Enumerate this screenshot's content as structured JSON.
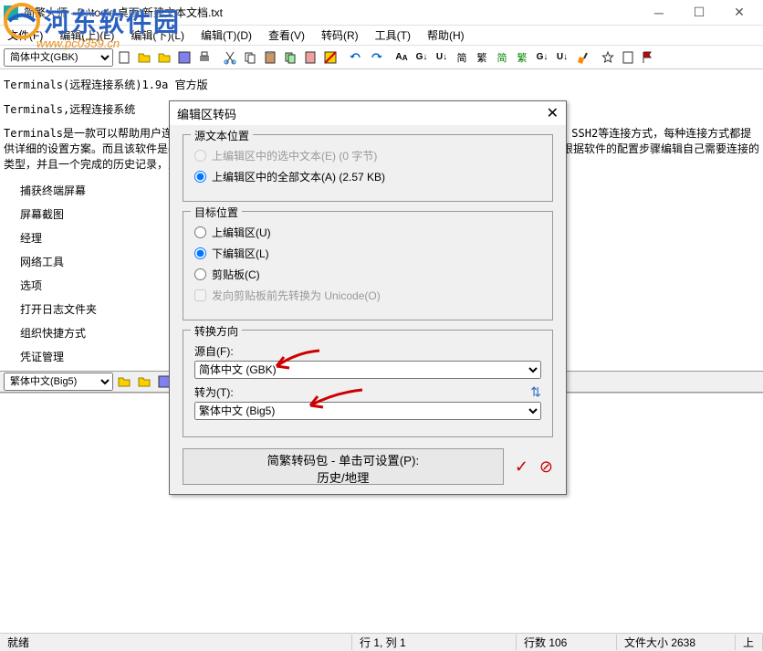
{
  "window": {
    "title": "简繁大师 - D:\\tools\\桌面\\新建文本文档.txt"
  },
  "watermark": {
    "text": "河东软件园",
    "url": "www.pc0359.cn"
  },
  "menu": {
    "items": [
      "文件(F)",
      "编辑(上)(E)",
      "编辑(下)(L)",
      "编辑(T)(D)",
      "查看(V)",
      "转码(R)",
      "工具(T)",
      "帮助(H)"
    ]
  },
  "toolbar": {
    "encoding": "简体中文(GBK)"
  },
  "content": {
    "line1": "Terminals(远程连接系统)1.9a 官方版",
    "line2": "Terminals,远程连接系统",
    "line3": "Terminals是一款可以帮助用户连接远程的工具，可以随时让您切换到任何能够RDP、VNC、VMRC、Telne、SSH1、SSH2等连接方式，每种连接方式都提供详细的设置方案。而且该软件是基于您自己单独设定的远程桌面才能进行高效的连接，所以打开软件的时候就可以根据软件的配置步骤编辑自己需要连接的类型，并且一个完成的历史记录，只要您有需求就可轻松配置多种远程及本地的连接方式！",
    "list": [
      "捕获终端屏幕",
      "屏幕截图",
      "经理",
      "网络工具",
      "选项",
      "打开日志文件夹",
      "组织快捷方式",
      "凭证管理"
    ]
  },
  "secondary": {
    "encoding": "繁体中文(Big5)"
  },
  "status": {
    "ready": "就绪",
    "position": "行 1, 列 1",
    "lines": "行数 106",
    "filesize": "文件大小 2638",
    "mode": "上"
  },
  "dialog": {
    "title": "编辑区转码",
    "group1": {
      "legend": "源文本位置",
      "opt1": "上编辑区中的选中文本(E) (0 字节)",
      "opt2": "上编辑区中的全部文本(A) (2.57 KB)"
    },
    "group2": {
      "legend": "目标位置",
      "opt1": "上编辑区(U)",
      "opt2": "下编辑区(L)",
      "opt3": "剪贴板(C)",
      "chk": "发向剪贴板前先转换为 Unicode(O)"
    },
    "group3": {
      "legend": "转换方向",
      "from_label": "源自(F):",
      "from_value": "简体中文 (GBK)",
      "to_label": "转为(T):",
      "to_value": "繁体中文 (Big5)"
    },
    "settings_btn_line1": "简繁转码包 - 单击可设置(P):",
    "settings_btn_line2": "历史/地理"
  }
}
